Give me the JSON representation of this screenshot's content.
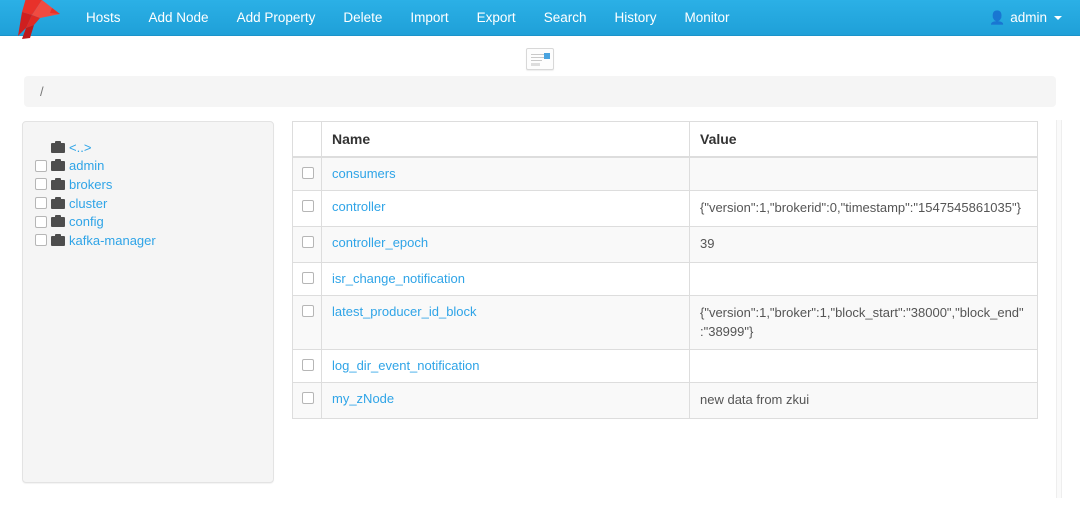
{
  "navbar": {
    "brand_icon": "red-bird-logo",
    "items": [
      {
        "label": "Hosts",
        "name": "hosts"
      },
      {
        "label": "Add Node",
        "name": "add-node"
      },
      {
        "label": "Add Property",
        "name": "add-property"
      },
      {
        "label": "Delete",
        "name": "delete"
      },
      {
        "label": "Import",
        "name": "import"
      },
      {
        "label": "Export",
        "name": "export"
      },
      {
        "label": "Search",
        "name": "search"
      },
      {
        "label": "History",
        "name": "history"
      },
      {
        "label": "Monitor",
        "name": "monitor"
      }
    ],
    "user": {
      "label": "admin",
      "icon": "user-icon",
      "caret": "caret-down-icon"
    },
    "colors": {
      "bg_top": "#2bb0e6",
      "bg_bottom": "#1fa0d8",
      "text": "#ffffff",
      "logo": "#e02020"
    }
  },
  "hero": {
    "image_icon": "broken-image-icon"
  },
  "breadcrumb": {
    "path": "/"
  },
  "sidebar": {
    "items": [
      {
        "label": "<..>",
        "icon": "folder-icon",
        "checkbox": false
      },
      {
        "label": "admin",
        "icon": "folder-icon",
        "checkbox": true
      },
      {
        "label": "brokers",
        "icon": "folder-icon",
        "checkbox": true
      },
      {
        "label": "cluster",
        "icon": "folder-icon",
        "checkbox": true
      },
      {
        "label": "config",
        "icon": "folder-icon",
        "checkbox": true
      },
      {
        "label": "kafka-manager",
        "icon": "folder-icon",
        "checkbox": true
      }
    ]
  },
  "table": {
    "columns": [
      "",
      "Name",
      "Value"
    ],
    "rows": [
      {
        "name": "consumers",
        "value": ""
      },
      {
        "name": "controller",
        "value": "{\"version\":1,\"brokerid\":0,\"timestamp\":\"1547545861035\"}"
      },
      {
        "name": "controller_epoch",
        "value": "39"
      },
      {
        "name": "isr_change_notification",
        "value": ""
      },
      {
        "name": "latest_producer_id_block",
        "value": "{\"version\":1,\"broker\":1,\"block_start\":\"38000\",\"block_end\":\"38999\"}"
      },
      {
        "name": "log_dir_event_notification",
        "value": ""
      },
      {
        "name": "my_zNode",
        "value": "new data from zkui"
      }
    ]
  },
  "colors": {
    "link": "#2fa4e7",
    "panel_bg": "#f5f5f5",
    "stripe": "#f9f9f9",
    "border": "#dddddd"
  }
}
